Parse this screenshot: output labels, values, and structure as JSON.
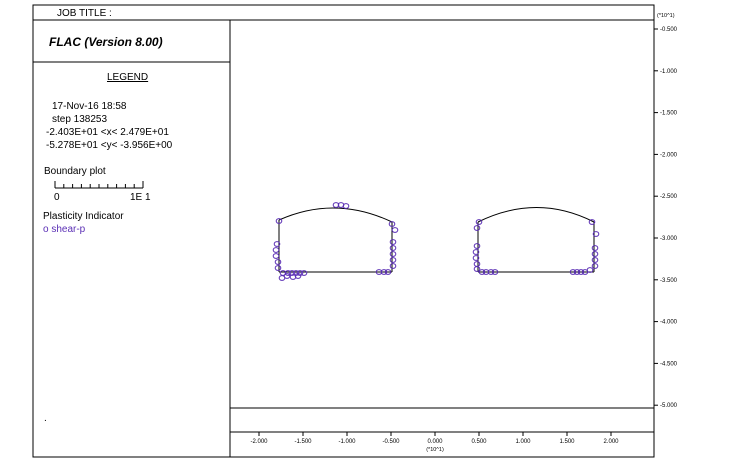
{
  "header": {
    "job_title_label": "JOB TITLE :",
    "program_title": "FLAC (Version 8.00)"
  },
  "legend": {
    "heading": "LEGEND",
    "date": "17-Nov-16  18:58",
    "step": "step    138253",
    "x_range": "-2.403E+01 <x<  2.479E+01",
    "y_range": "-5.278E+01 <y< -3.956E+00",
    "boundary_plot_label": "Boundary plot",
    "scale_min": "0",
    "scale_max": "1E 1",
    "plasticity_label": "Plasticity Indicator",
    "plasticity_entry": "o shear-p",
    "bottom_mark": "."
  },
  "axes": {
    "x_multiplier": "(*10^1)",
    "y_multiplier": "(*10^1)",
    "x_ticks": [
      "-2.000",
      "-1.500",
      "-1.000",
      "-0.500",
      "0.000",
      "0.500",
      "1.000",
      "1.500",
      "2.000"
    ],
    "y_ticks": [
      "-0.500",
      "-1.000",
      "-1.500",
      "-2.000",
      "-2.500",
      "-3.000",
      "-3.500",
      "-4.000",
      "-4.500",
      "-5.000"
    ]
  },
  "colors": {
    "boundary": "#000000",
    "plasticity_marker": "#5b2fb5"
  }
}
